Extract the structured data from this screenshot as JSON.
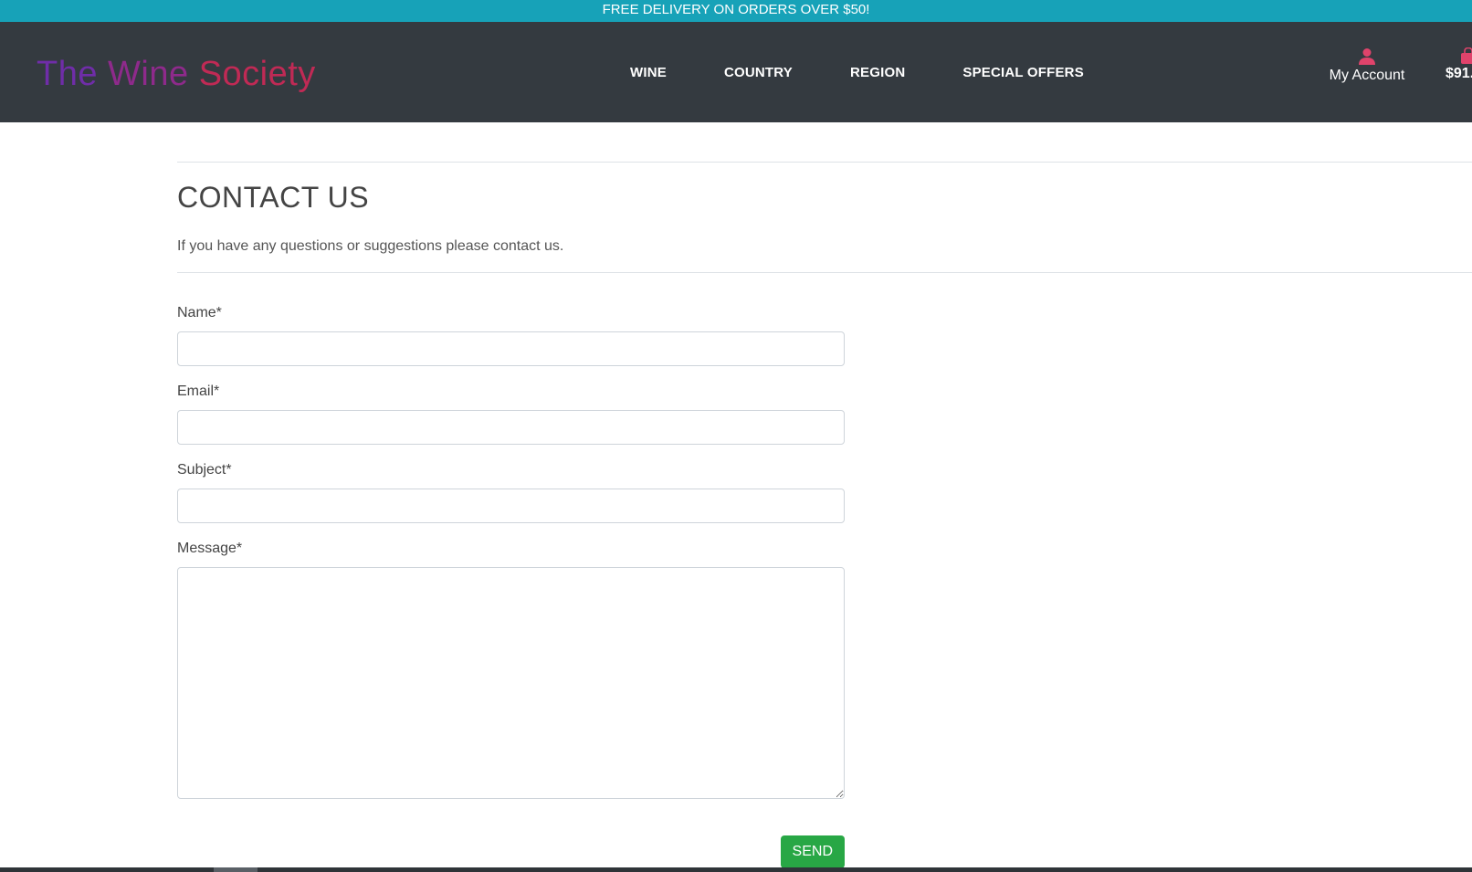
{
  "promo": {
    "text": "FREE DELIVERY ON ORDERS OVER $50!"
  },
  "header": {
    "brand": {
      "word1": "The",
      "word2": "Wine",
      "word3": "Society"
    },
    "nav": [
      {
        "label": "WINE"
      },
      {
        "label": "COUNTRY"
      },
      {
        "label": "REGION"
      },
      {
        "label": "SPECIAL OFFERS"
      }
    ],
    "account": {
      "label": "My Account",
      "icon": "user-icon"
    },
    "bag": {
      "total": "$91.",
      "icon": "shopping-bag-icon"
    }
  },
  "page": {
    "title": "CONTACT US",
    "intro": "If you have any questions or suggestions please contact us."
  },
  "form": {
    "name_label": "Name*",
    "name_value": "",
    "email_label": "Email*",
    "email_value": "",
    "subject_label": "Subject*",
    "subject_value": "",
    "message_label": "Message*",
    "message_value": "",
    "send_label": "SEND"
  },
  "colors": {
    "promo_bg": "#17a2b8",
    "header_bg": "#343a40",
    "brand_purple": "#6f2da8",
    "brand_red": "#c02a55",
    "accent_pink": "#e0436b",
    "send_green": "#28a745"
  }
}
